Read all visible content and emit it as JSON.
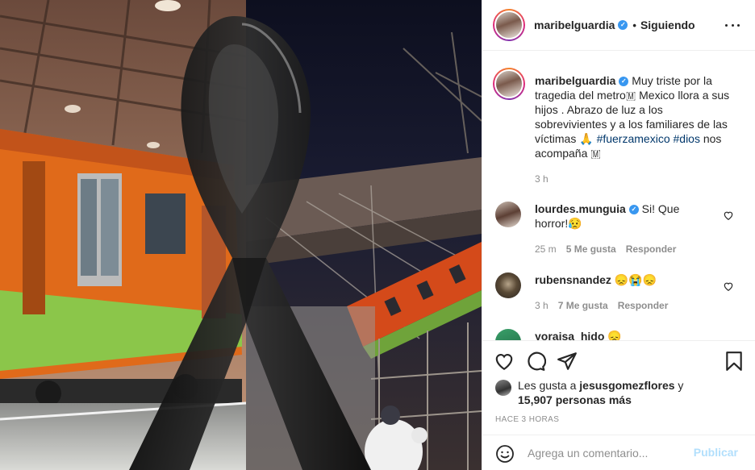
{
  "header": {
    "username": "maribelguardia",
    "verified_mark": "✓",
    "separator": "•",
    "follow_status": "Siguiendo",
    "more_icon": "more-horizontal-icon"
  },
  "caption": {
    "username": "maribelguardia",
    "text_part1": " Muy triste por la tragedia del metro🇲 Mexico llora a sus hijos . Abrazo de luz a los sobrevivientes y a los familiares de las víctimas 🙏 ",
    "hashtag1": "#fuerzamexico",
    "space": " ",
    "hashtag2": "#dios",
    "text_part2": " nos acompaña 🇲",
    "time": "3 h"
  },
  "comments": [
    {
      "username": "lourdes.munguia",
      "verified_mark": "✓",
      "text": " Si! Que horror!😥",
      "time": "25 m",
      "likes": "5 Me gusta",
      "reply": "Responder"
    },
    {
      "username": "rubensnandez",
      "text": " 😞😭😞",
      "time": "3 h",
      "likes": "7 Me gusta",
      "reply": "Responder"
    },
    {
      "username": "yoraisa_hido",
      "text": " 😞"
    }
  ],
  "likes": {
    "prefix": "Les gusta a ",
    "user": "jesusgomezflores",
    "conj": " y",
    "count": "15,907 personas más"
  },
  "posted_ago": "HACE 3 HORAS",
  "add_comment": {
    "placeholder": "Agrega un comentario...",
    "publish": "Publicar"
  },
  "colors": {
    "link": "#00376b",
    "verified": "#3897f0",
    "publish_disabled": "#b2dffc",
    "secondary_text": "#8e8e8e"
  }
}
